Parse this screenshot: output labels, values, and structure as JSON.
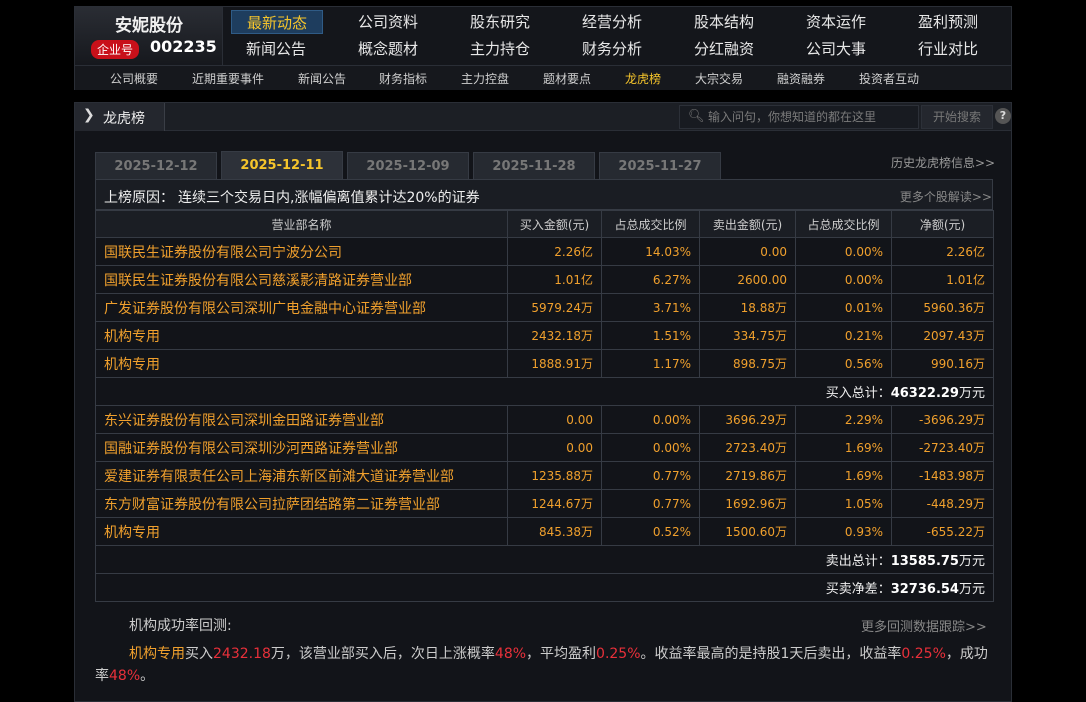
{
  "company": {
    "name": "安妮股份",
    "badge": "企业号",
    "code": "002235"
  },
  "nav_row1": [
    "最新动态",
    "公司资料",
    "股东研究",
    "经营分析",
    "股本结构",
    "资本运作",
    "盈利预测"
  ],
  "nav_row2": [
    "新闻公告",
    "概念题材",
    "主力持仓",
    "财务分析",
    "分红融资",
    "公司大事",
    "行业对比"
  ],
  "subnav": [
    "公司概要",
    "近期重要事件",
    "新闻公告",
    "财务指标",
    "主力控盘",
    "题材要点",
    "龙虎榜",
    "大宗交易",
    "融资融券",
    "投资者互动"
  ],
  "panel": {
    "title": "龙虎榜",
    "search_placeholder": "输入问句，你想知道的都在这里",
    "search_button": "开始搜索",
    "help": "?"
  },
  "tabs": [
    "2025-12-12",
    "2025-12-11",
    "2025-12-09",
    "2025-11-28",
    "2025-11-27"
  ],
  "history_link": "历史龙虎榜信息>>",
  "reason": {
    "label": "上榜原因：",
    "text": "连续三个交易日内,涨幅偏离值累计达20%的证券",
    "more": "更多个股解读>>"
  },
  "table": {
    "headers": [
      "营业部名称",
      "买入金额(元)",
      "占总成交比例",
      "卖出金额(元)",
      "占总成交比例",
      "净额(元)"
    ],
    "buy_rows": [
      [
        "国联民生证券股份有限公司宁波分公司",
        "2.26亿",
        "14.03%",
        "0.00",
        "0.00%",
        "2.26亿"
      ],
      [
        "国联民生证券股份有限公司慈溪影清路证券营业部",
        "1.01亿",
        "6.27%",
        "2600.00",
        "0.00%",
        "1.01亿"
      ],
      [
        "广发证券股份有限公司深圳广电金融中心证券营业部",
        "5979.24万",
        "3.71%",
        "18.88万",
        "0.01%",
        "5960.36万"
      ],
      [
        "机构专用",
        "2432.18万",
        "1.51%",
        "334.75万",
        "0.21%",
        "2097.43万"
      ],
      [
        "机构专用",
        "1888.91万",
        "1.17%",
        "898.75万",
        "0.56%",
        "990.16万"
      ]
    ],
    "buy_total_label": "买入总计：",
    "buy_total_value": "46322.29",
    "sell_rows": [
      [
        "东兴证券股份有限公司深圳金田路证券营业部",
        "0.00",
        "0.00%",
        "3696.29万",
        "2.29%",
        "-3696.29万"
      ],
      [
        "国融证券股份有限公司深圳沙河西路证券营业部",
        "0.00",
        "0.00%",
        "2723.40万",
        "1.69%",
        "-2723.40万"
      ],
      [
        "爱建证券有限责任公司上海浦东新区前滩大道证券营业部",
        "1235.88万",
        "0.77%",
        "2719.86万",
        "1.69%",
        "-1483.98万"
      ],
      [
        "东方财富证券股份有限公司拉萨团结路第二证券营业部",
        "1244.67万",
        "0.77%",
        "1692.96万",
        "1.05%",
        "-448.29万"
      ],
      [
        "机构专用",
        "845.38万",
        "0.52%",
        "1500.60万",
        "0.93%",
        "-655.22万"
      ]
    ],
    "sell_total_label": "卖出总计：",
    "sell_total_value": "13585.75",
    "net_label": "买卖净差：",
    "net_value": "32736.54",
    "unit": "万元"
  },
  "backtest": {
    "label": "机构成功率回测:",
    "more": "更多回测数据跟踪>>",
    "seat": "机构专用",
    "t1": "买入",
    "amount": "2432.18",
    "t2": "万，该营业部买入后，次日上涨概率",
    "prob": "48%",
    "t3": "，平均盈利",
    "avg": "0.25%",
    "t4": "。收益率最高的是持股1天后卖出，收益率",
    "rate": "0.25%",
    "t5": "，成功率",
    "success": "48%",
    "t6": "。"
  },
  "colors": {
    "accent": "#f6c52b",
    "value_orange": "#f0a02d",
    "highlight_red": "#e8303a",
    "badge_red": "#c8101a"
  }
}
